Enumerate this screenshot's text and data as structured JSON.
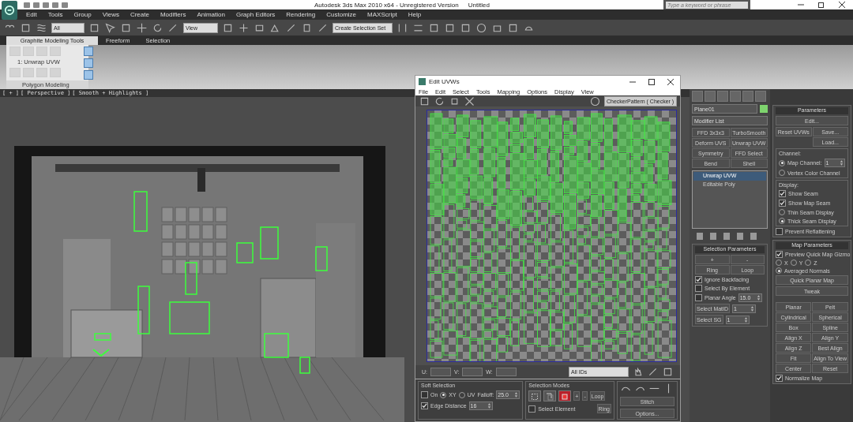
{
  "window": {
    "title": "Autodesk 3ds Max  2010 x64  - Unregistered Version",
    "document": "Untitled"
  },
  "help_search": {
    "placeholder": "Type a keyword or phrase"
  },
  "menu": [
    "Edit",
    "Tools",
    "Group",
    "Views",
    "Create",
    "Modifiers",
    "Animation",
    "Graph Editors",
    "Rendering",
    "Customize",
    "MAXScript",
    "Help"
  ],
  "main_toolbar": {
    "selection_filter": "All",
    "reference_coordinate": "View",
    "named_selection": "Create Selection Set"
  },
  "ribbon": {
    "tabs": [
      {
        "label": "Graphite Modeling Tools",
        "selected": true
      },
      {
        "label": "Freeform",
        "selected": false
      },
      {
        "label": "Selection",
        "selected": false
      }
    ],
    "modifier": "1: Unwrap UVW",
    "panel_title": "Polygon Modeling"
  },
  "viewport": {
    "labels": [
      "[ + ]",
      "[ Perspective ]",
      "[ Smooth + Highlights ]"
    ]
  },
  "uv_editor": {
    "title": "Edit UVWs",
    "menu": [
      "File",
      "Edit",
      "Select",
      "Tools",
      "Mapping",
      "Options",
      "Display",
      "View"
    ],
    "texture": "CheckerPattern  ( Checker )",
    "coords": [
      "U:",
      "V:",
      "W:"
    ],
    "id_filter": "All IDs",
    "soft_selection": {
      "title": "Soft Selection",
      "on": {
        "label": "On",
        "checked": false
      },
      "spaces": [
        {
          "label": "XY",
          "selected": true
        },
        {
          "label": "UV",
          "selected": false
        }
      ],
      "falloff_label": "Falloff:",
      "falloff": "25.0",
      "edge_distance": {
        "label": "Edge Distance",
        "checked": true
      },
      "edge_distance_value": "16"
    },
    "selection_modes": {
      "title": "Selection Modes",
      "modes": [
        {
          "kind": "vertex",
          "selected": false
        },
        {
          "kind": "edge",
          "selected": false
        },
        {
          "kind": "face",
          "selected": true
        }
      ],
      "grow": "+",
      "shrink": "-",
      "loop": "Loop",
      "ring": "Ring",
      "select_element": {
        "label": "Select Element",
        "checked": false
      }
    },
    "stitch": "Stitch",
    "options": "Options..."
  },
  "command_panel": {
    "object_name": "Plane01",
    "modifier_list": "Modifier List",
    "modifier_buttons": [
      "FFD 3x3x3",
      "TurboSmooth",
      "Deform UVS",
      "Unwrap UVW",
      "Symmetry",
      "FFD Select",
      "Bend",
      "Shell"
    ],
    "stack": [
      {
        "label": "Unwrap UVW",
        "selected": true
      },
      {
        "label": "Editable Poly",
        "selected": false
      }
    ],
    "selection_parameters": {
      "title": "Selection Parameters",
      "grow": "+",
      "shrink": "-",
      "ring": "Ring",
      "loop": "Loop",
      "options": [
        {
          "label": "Ignore Backfacing",
          "checked": true
        },
        {
          "label": "Select By Element",
          "checked": false
        },
        {
          "label": "Planar Angle",
          "checked": false
        }
      ],
      "planar_angle": "15.0",
      "select_matid": "Select MatID",
      "matid": "1",
      "select_sg": "Select SG",
      "sg": "1"
    }
  },
  "parameters": {
    "title": "Parameters",
    "edit": "Edit...",
    "reset": "Reset UVWs",
    "save": "Save...",
    "load": "Load...",
    "channel_title": "Channel:",
    "channels": [
      {
        "label": "Map Channel:",
        "selected": true
      },
      {
        "label": "Vertex Color Channel",
        "selected": false
      }
    ],
    "map_channel": "1",
    "display_title": "Display:",
    "seams": [
      {
        "label": "Show Seam",
        "checked": true
      },
      {
        "label": "Show Map Seam",
        "checked": true
      }
    ],
    "seam_display": [
      {
        "label": "Thin Seam Display",
        "selected": false
      },
      {
        "label": "Thick Seam Display",
        "selected": true
      }
    ],
    "prevent_reflattening": {
      "label": "Prevent Reflattening",
      "checked": false
    }
  },
  "map_parameters": {
    "title": "Map Parameters",
    "preview": {
      "label": "Preview Quick Map Gizmo",
      "checked": true
    },
    "axes": [
      {
        "label": "X",
        "selected": false
      },
      {
        "label": "Y",
        "selected": false
      },
      {
        "label": "Z",
        "selected": false
      },
      {
        "label": "Averaged Normals",
        "selected": true
      }
    ],
    "quick_planar": "Quick Planar Map",
    "tweak": "Tweak",
    "buttons": [
      "Planar",
      "Pelt",
      "Cylindrical",
      "Spherical",
      "Box",
      "Spline",
      "Align X",
      "Align Y",
      "Align Z",
      "Best Align",
      "Fit",
      "Align To View",
      "Center",
      "Reset"
    ],
    "normalize": {
      "label": "Normalize Map",
      "checked": true
    }
  }
}
